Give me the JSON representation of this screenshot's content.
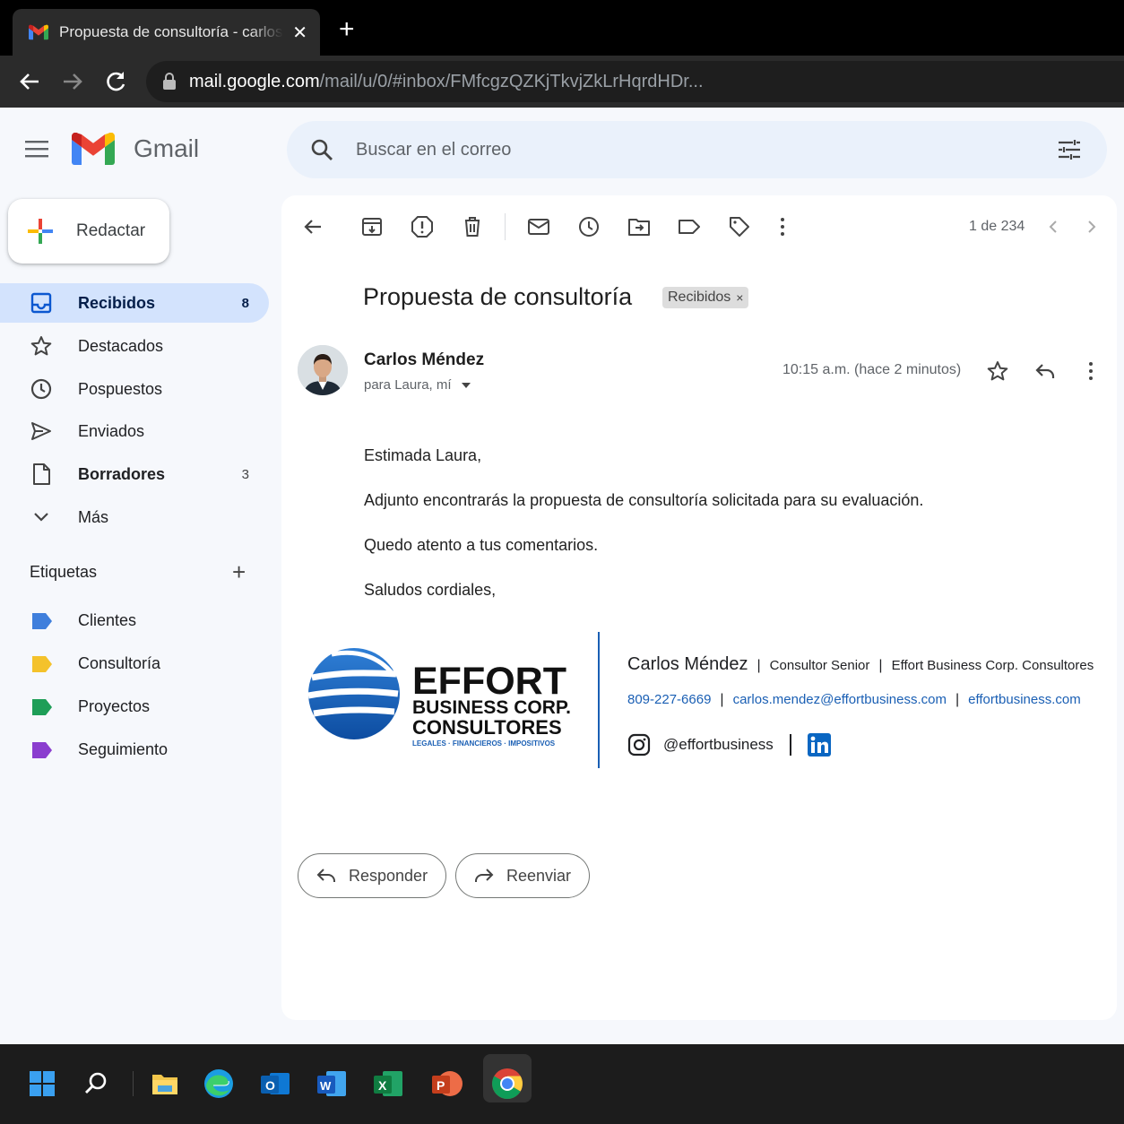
{
  "browser": {
    "tab_title": "Propuesta de consultoría - carlos.mendez@effortbusiness.com",
    "url_host": "mail.google.com",
    "url_path": "/mail/u/0/#inbox/FMfcgzQZKjTkvjZkLrHqrdHDr..."
  },
  "gmail": {
    "product_name": "Gmail",
    "search_placeholder": "Buscar en el correo",
    "compose_label": "Redactar",
    "nav": [
      {
        "label": "Recibidos",
        "count": "8"
      },
      {
        "label": "Destacados",
        "count": ""
      },
      {
        "label": "Pospuestos",
        "count": ""
      },
      {
        "label": "Enviados",
        "count": ""
      },
      {
        "label": "Borradores",
        "count": "3"
      },
      {
        "label": "Más",
        "count": ""
      }
    ],
    "labels_heading": "Etiquetas",
    "labels": [
      {
        "label": "Clientes",
        "color": "#3f7fdc"
      },
      {
        "label": "Consultoría",
        "color": "#f4c22b"
      },
      {
        "label": "Proyectos",
        "color": "#1e9e57"
      },
      {
        "label": "Seguimiento",
        "color": "#8b3ecf"
      }
    ]
  },
  "message": {
    "pager": "1 de 234",
    "subject": "Propuesta de consultoría",
    "folder_chip": "Recibidos",
    "chip_close": "×",
    "sender": "Carlos Méndez",
    "recipients": "para Laura, mí",
    "time": "10:15 a.m. (hace 2 minutos)",
    "greeting": "Estimada Laura,",
    "line1": "Adjunto encontrarás la propuesta de consultoría solicitada para su evaluación.",
    "line2": "Quedo atento a tus comentarios.",
    "closing": "Saludos cordiales,"
  },
  "signature": {
    "logo_word": "EFFORT",
    "logo_line2": "BUSINESS CORP.",
    "logo_line3": "CONSULTORES",
    "logo_tagline": "LEGALES · FINANCIEROS · IMPOSITIVOS",
    "name": "Carlos Méndez",
    "role": "Consultor Senior",
    "company": "Effort Business Corp. Consultores",
    "phone": "809-227-6669",
    "email": "carlos.mendez@effortbusiness.com",
    "website": "effortbusiness.com",
    "instagram": "@effortbusiness",
    "separator": "|"
  },
  "actions": {
    "reply": "Responder",
    "forward": "Reenviar"
  },
  "colors": {
    "accent_blue": "#1a5fb4",
    "active_nav_bg": "#d3e3fd"
  }
}
